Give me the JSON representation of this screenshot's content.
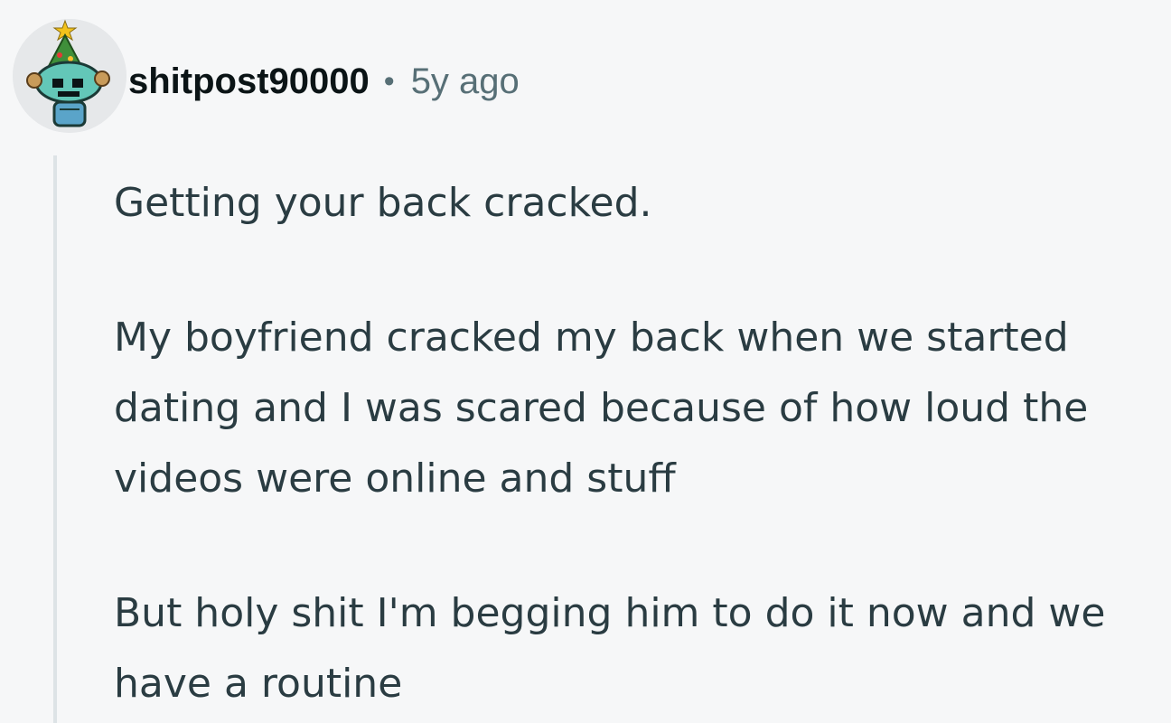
{
  "comment": {
    "author": {
      "username": "shitpost90000",
      "avatar_icon": "snoo-avatar-icon"
    },
    "separator": "•",
    "timestamp": "5y ago",
    "paragraphs": [
      "Getting your back cracked.",
      "My boyfriend cracked my back when we started dating and I was scared because of how loud the videos were online and stuff",
      "But holy shit I'm begging him to do it now and we have a routine"
    ]
  },
  "colors": {
    "background": "#f6f7f8",
    "username": "#0b1416",
    "meta": "#576f76",
    "body": "#2a3c42",
    "thread_line": "#dde3e6"
  }
}
